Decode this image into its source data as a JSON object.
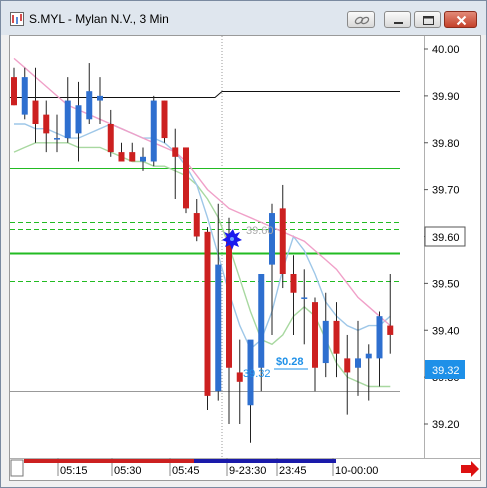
{
  "window": {
    "title": "S.MYL - Mylan N.V., 3 Min"
  },
  "price_axis": {
    "ticks": [
      "40.00",
      "39.90",
      "39.80",
      "39.70",
      "39.60",
      "39.50",
      "39.40",
      "39.30",
      "39.20"
    ],
    "current_price_label": "39.60",
    "alt_price_label": "39.32"
  },
  "time_axis": {
    "ticks": [
      "05:15",
      "05:30",
      "05:45",
      "9-23:30",
      "23:45",
      "10-00:00"
    ]
  },
  "annotations": {
    "order_label": "39.60",
    "pl_label": "$0.28",
    "fill_label": "39.32"
  },
  "colors": {
    "up_candle": "#2e6fcf",
    "down_candle": "#cc2020",
    "ma_fast": "#9ec7e8",
    "ma_slow": "#f0a0c8",
    "ma_green": "#a8d8a0",
    "level_green": "#22bb22",
    "pl_text": "#1e90e8"
  },
  "icons": {
    "scroll_right": "red-arrow-right-icon",
    "title": "chart-icon"
  },
  "chart_data": {
    "type": "candlestick",
    "ylim": [
      39.15,
      40.04
    ],
    "candles": [
      {
        "o": 39.94,
        "h": 39.96,
        "l": 39.88,
        "c": 39.88
      },
      {
        "o": 39.86,
        "h": 39.96,
        "l": 39.85,
        "c": 39.94
      },
      {
        "o": 39.89,
        "h": 39.96,
        "l": 39.8,
        "c": 39.84
      },
      {
        "o": 39.86,
        "h": 39.89,
        "l": 39.78,
        "c": 39.82
      },
      {
        "o": 39.81,
        "h": 39.86,
        "l": 39.78,
        "c": 39.81
      },
      {
        "o": 39.81,
        "h": 39.94,
        "l": 39.8,
        "c": 39.89
      },
      {
        "o": 39.82,
        "h": 39.93,
        "l": 39.76,
        "c": 39.88
      },
      {
        "o": 39.85,
        "h": 39.97,
        "l": 39.84,
        "c": 39.91
      },
      {
        "o": 39.89,
        "h": 39.94,
        "l": 39.84,
        "c": 39.9
      },
      {
        "o": 39.84,
        "h": 39.87,
        "l": 39.77,
        "c": 39.78
      },
      {
        "o": 39.78,
        "h": 39.8,
        "l": 39.76,
        "c": 39.76
      },
      {
        "o": 39.78,
        "h": 39.8,
        "l": 39.76,
        "c": 39.76
      },
      {
        "o": 39.76,
        "h": 39.79,
        "l": 39.74,
        "c": 39.77
      },
      {
        "o": 39.76,
        "h": 39.9,
        "l": 39.75,
        "c": 39.89
      },
      {
        "o": 39.89,
        "h": 39.89,
        "l": 39.8,
        "c": 39.81
      },
      {
        "o": 39.79,
        "h": 39.83,
        "l": 39.68,
        "c": 39.77
      },
      {
        "o": 39.79,
        "h": 39.79,
        "l": 39.65,
        "c": 39.66
      },
      {
        "o": 39.65,
        "h": 39.68,
        "l": 39.59,
        "c": 39.6
      },
      {
        "o": 39.61,
        "h": 39.62,
        "l": 39.23,
        "c": 39.26
      },
      {
        "o": 39.27,
        "h": 39.67,
        "l": 39.25,
        "c": 39.54
      },
      {
        "o": 39.6,
        "h": 39.64,
        "l": 39.2,
        "c": 39.32
      },
      {
        "o": 39.31,
        "h": 39.38,
        "l": 39.2,
        "c": 39.29
      },
      {
        "o": 39.24,
        "h": 39.37,
        "l": 39.16,
        "c": 39.38
      },
      {
        "o": 39.32,
        "h": 39.52,
        "l": 39.27,
        "c": 39.52
      },
      {
        "o": 39.54,
        "h": 39.67,
        "l": 39.39,
        "c": 39.65
      },
      {
        "o": 39.66,
        "h": 39.71,
        "l": 39.49,
        "c": 39.52
      },
      {
        "o": 39.52,
        "h": 39.56,
        "l": 39.39,
        "c": 39.48
      },
      {
        "o": 39.47,
        "h": 39.53,
        "l": 39.37,
        "c": 39.47
      },
      {
        "o": 39.46,
        "h": 39.47,
        "l": 39.27,
        "c": 39.32
      },
      {
        "o": 39.33,
        "h": 39.48,
        "l": 39.3,
        "c": 39.42
      },
      {
        "o": 39.42,
        "h": 39.46,
        "l": 39.3,
        "c": 39.35
      },
      {
        "o": 39.34,
        "h": 39.39,
        "l": 39.22,
        "c": 39.31
      },
      {
        "o": 39.32,
        "h": 39.42,
        "l": 39.26,
        "c": 39.34
      },
      {
        "o": 39.34,
        "h": 39.37,
        "l": 39.25,
        "c": 39.35
      },
      {
        "o": 39.34,
        "h": 39.44,
        "l": 39.28,
        "c": 39.43
      },
      {
        "o": 39.41,
        "h": 39.52,
        "l": 39.35,
        "c": 39.39
      }
    ],
    "ma_fast": [
      39.84,
      39.84,
      39.83,
      39.83,
      39.82,
      39.81,
      39.81,
      39.82,
      39.83,
      39.84,
      39.83,
      39.82,
      39.81,
      39.81,
      39.8,
      39.78,
      39.75,
      39.71,
      39.64,
      39.56,
      39.48,
      39.41,
      39.36,
      39.38,
      39.44,
      39.53,
      39.6,
      39.57,
      39.52,
      39.46,
      39.43,
      39.41,
      39.4,
      39.41,
      39.41,
      39.43
    ],
    "ma_slow": [
      39.98,
      39.96,
      39.94,
      39.92,
      39.9,
      39.88,
      39.87,
      39.86,
      39.85,
      39.84,
      39.83,
      39.82,
      39.81,
      39.8,
      39.79,
      39.78,
      39.76,
      39.73,
      39.7,
      39.68,
      39.66,
      39.65,
      39.64,
      39.63,
      39.62,
      39.61,
      39.6,
      39.59,
      39.57,
      39.55,
      39.53,
      39.5,
      39.47,
      39.45,
      39.43,
      39.41
    ],
    "ma_green": [
      39.78,
      39.79,
      39.8,
      39.8,
      39.8,
      39.8,
      39.79,
      39.79,
      39.79,
      39.78,
      39.77,
      39.76,
      39.76,
      39.75,
      39.75,
      39.74,
      39.73,
      39.71,
      39.68,
      39.64,
      39.58,
      39.51,
      39.44,
      39.38,
      39.37,
      39.39,
      39.43,
      39.45,
      39.43,
      39.38,
      39.33,
      39.3,
      39.29,
      39.28,
      39.28,
      39.28
    ],
    "horizontal_levels": [
      {
        "price": 40.04,
        "style": "solid-red-partial"
      },
      {
        "price": 39.897,
        "style": "solid-black-step"
      },
      {
        "price": 39.747,
        "style": "solid-green"
      },
      {
        "price": 39.63,
        "style": "dashed-green"
      },
      {
        "price": 39.615,
        "style": "dashed-green"
      },
      {
        "price": 39.565,
        "style": "solid-green-bold"
      },
      {
        "price": 39.505,
        "style": "dashed-green"
      },
      {
        "price": 39.27,
        "style": "solid-gray"
      }
    ]
  }
}
